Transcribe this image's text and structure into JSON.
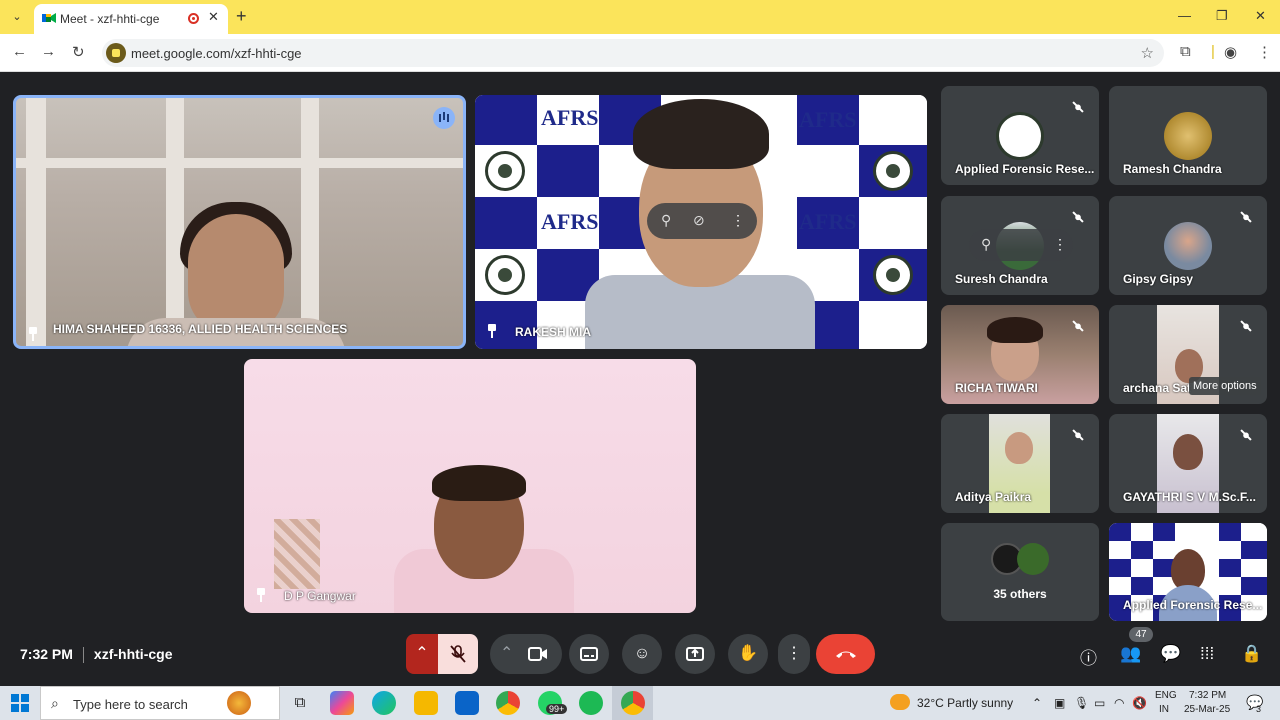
{
  "browser": {
    "tab_title": "Meet - xzf-hhti-cge",
    "url": "meet.google.com/xzf-hhti-cge",
    "new_tab": "+",
    "close_tab": "✕",
    "window_controls": {
      "minimize": "—",
      "maximize": "❐",
      "close": "✕"
    }
  },
  "meet": {
    "main_tiles": [
      {
        "name": "HIMA SHAHEED 16336, ALLIED HEALTH SCIENCES",
        "pinned": true,
        "speaking": true
      },
      {
        "name": "RAKESH MIA",
        "pinned": true,
        "muted": true,
        "background_text": "AFRS"
      },
      {
        "name": "D P Gangwar",
        "pinned": true
      }
    ],
    "side_tiles": [
      {
        "name": "Applied Forensic Rese...",
        "muted": true
      },
      {
        "name": "Ramesh Chandra"
      },
      {
        "name": "Suresh Chandra",
        "muted": true
      },
      {
        "name": "Gipsy Gipsy",
        "muted": true
      },
      {
        "name": "RICHA TIWARI",
        "muted": true
      },
      {
        "name": "archana Sat",
        "muted": true,
        "tooltip": "More options"
      },
      {
        "name": "Aditya Paikra",
        "muted": true
      },
      {
        "name": "GAYATHRI S V M.Sc.F...",
        "muted": true
      },
      {
        "name": "35 others"
      },
      {
        "name": "Applied Forensic Rese..."
      }
    ],
    "clock": "7:32 PM",
    "meeting_code": "xzf-hhti-cge",
    "participants_count": "47",
    "icons": {
      "mic": "mic-off-icon",
      "camera": "camera-icon",
      "captions": "captions-icon",
      "emoji": "emoji-icon",
      "present": "present-icon",
      "hand": "raise-hand-icon",
      "more": "more-options-icon",
      "leave": "leave-call-icon"
    },
    "colors": {
      "leave": "#ea4335",
      "speaking": "#8ab4f8",
      "tile_bg": "#3c4043",
      "page_bg": "#202124"
    }
  },
  "taskbar": {
    "search_placeholder": "Type here to search",
    "weather": "32°C  Partly sunny",
    "lang_top": "ENG",
    "lang_bottom": "IN",
    "time": "7:32 PM",
    "date": "25-Mar-25",
    "whatsapp_badge": "99+",
    "notif_badge": "3"
  }
}
